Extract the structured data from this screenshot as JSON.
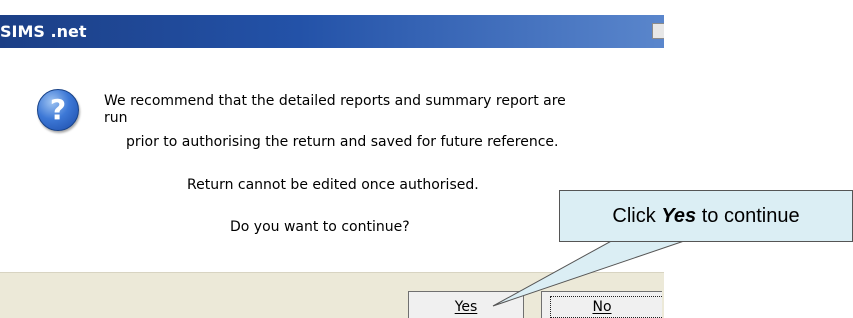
{
  "dialog": {
    "title": "SIMS .net",
    "message": {
      "line1": "We recommend that the detailed reports and summary report are",
      "line2": "run",
      "line3": "prior to authorising the return and saved for future reference.",
      "line4": "Return cannot be edited once authorised.",
      "line5": "Do you want to continue?"
    },
    "icon": "question-icon",
    "buttons": {
      "yes": "Yes",
      "no": "No"
    }
  },
  "callout": {
    "prefix": "Click ",
    "emphasis": "Yes",
    "suffix": " to continue",
    "fill_color": "#dbeef4"
  },
  "colors": {
    "titlebar": "#1c3f86",
    "button_bar": "#ece9d8"
  }
}
